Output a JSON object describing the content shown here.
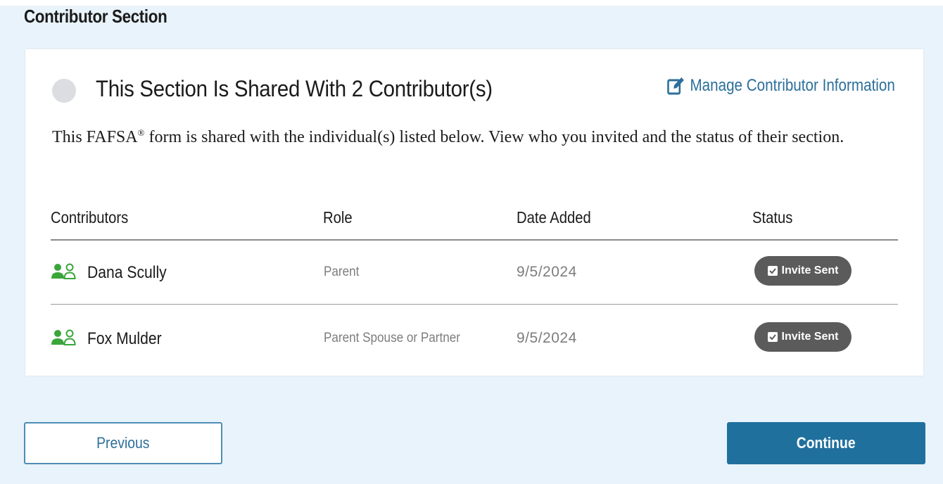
{
  "page": {
    "section_title": "Contributor Section"
  },
  "card": {
    "heading": "This Section Is Shared With 2 Contributor(s)",
    "manage_link": "Manage Contributor Information",
    "intro_before_sup": "This FAFSA",
    "intro_sup": "®",
    "intro_after_sup": " form is shared with the individual(s) listed below. View who you invited and the status of their section."
  },
  "table": {
    "headers": {
      "contributors": "Contributors",
      "role": "Role",
      "date_added": "Date Added",
      "status": "Status"
    },
    "rows": [
      {
        "name": "Dana Scully",
        "role": "Parent",
        "date": "9/5/2024",
        "status": "Invite Sent"
      },
      {
        "name": "Fox Mulder",
        "role": "Parent Spouse or Partner",
        "date": "9/5/2024",
        "status": "Invite Sent"
      }
    ]
  },
  "buttons": {
    "previous": "Previous",
    "continue": "Continue"
  },
  "colors": {
    "background": "#e9f3fb",
    "link": "#2c6f9a",
    "primary_button": "#20709d",
    "badge": "#5b5b5b",
    "contributor_icon": "#3aa63a"
  },
  "icons": {
    "manage": "edit-icon",
    "contributor": "people-icon",
    "status_check": "checkbox-icon"
  }
}
